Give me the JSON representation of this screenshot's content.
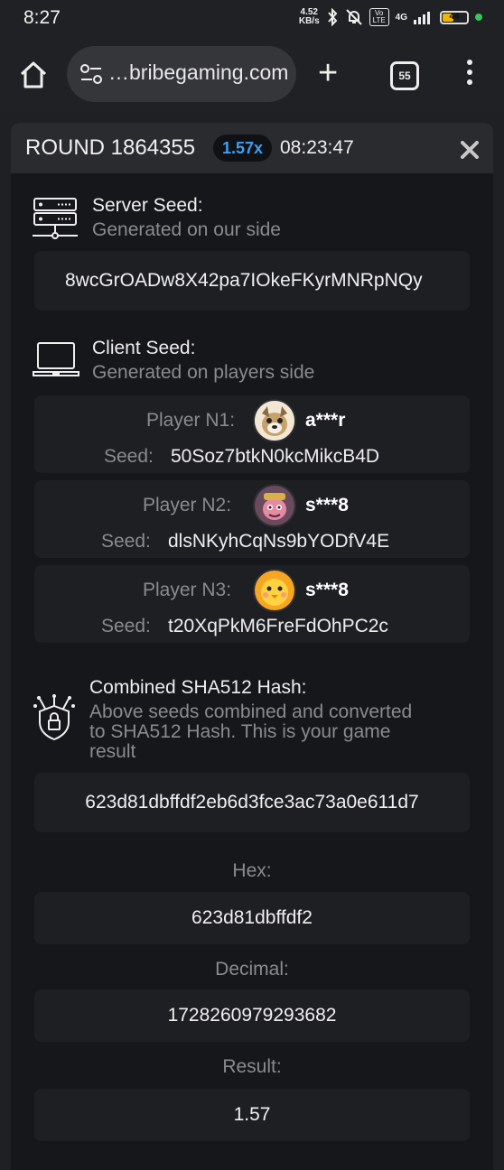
{
  "status": {
    "time": "8:27",
    "net_speed_top": "4.52",
    "net_speed_unit": "KB/s",
    "volte": "Vo LTE",
    "network": "4G",
    "battery": "44"
  },
  "browser": {
    "url": "…bribegaming.com",
    "tab_count": "55"
  },
  "modal": {
    "round_label": "ROUND 1864355",
    "multiplier": "1.57x",
    "time": "08:23:47",
    "server_seed": {
      "title": "Server Seed:",
      "subtitle": "Generated on our side",
      "value": "8wcGrOADw8X42pa7IOkeFKyrMNRpNQy"
    },
    "client_seed": {
      "title": "Client Seed:",
      "subtitle": "Generated on players side",
      "players": [
        {
          "label": "Player N1:",
          "name": "a***r",
          "seed_label": "Seed:",
          "seed": "50Soz7btkN0kcMikcB4D"
        },
        {
          "label": "Player N2:",
          "name": "s***8",
          "seed_label": "Seed:",
          "seed": "dlsNKyhCqNs9bYODfV4E"
        },
        {
          "label": "Player N3:",
          "name": "s***8",
          "seed_label": "Seed:",
          "seed": "t20XqPkM6FreFdOhPC2c"
        }
      ]
    },
    "hash": {
      "title": "Combined SHA512 Hash:",
      "subtitle_1": "Above seeds combined and converted",
      "subtitle_2": "to SHA512 Hash. This is your game",
      "subtitle_3": "result",
      "value": "623d81dbffdf2eb6d3fce3ac73a0e611d7"
    },
    "hex": {
      "label": "Hex:",
      "value": "623d81dbffdf2"
    },
    "decimal": {
      "label": "Decimal:",
      "value": "1728260979293682"
    },
    "result": {
      "label": "Result:",
      "value": "1.57"
    }
  }
}
